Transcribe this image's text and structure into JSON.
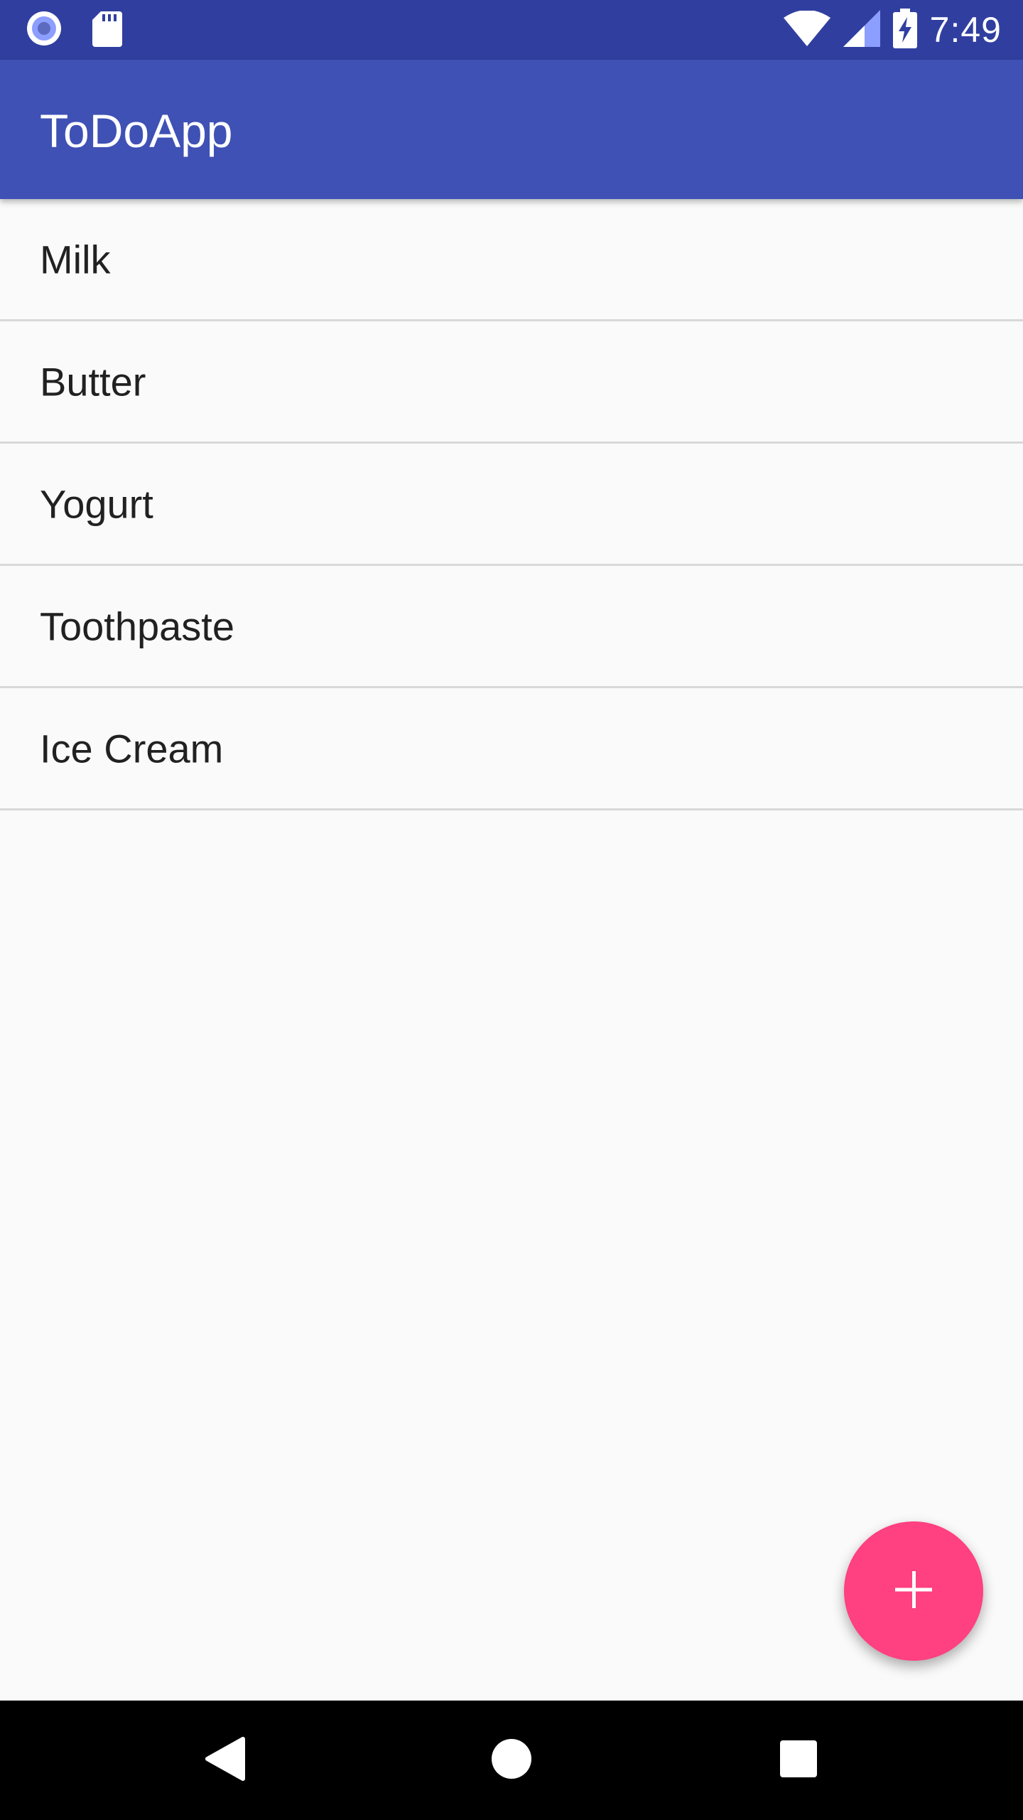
{
  "status_bar": {
    "time": "7:49",
    "left_icons": [
      "cast-record-icon",
      "sd-card-icon"
    ],
    "right_icons": [
      "wifi-icon",
      "cell-signal-icon",
      "battery-charging-icon"
    ]
  },
  "app_bar": {
    "title": "ToDoApp"
  },
  "todo_list": {
    "items": [
      {
        "label": "Milk"
      },
      {
        "label": "Butter"
      },
      {
        "label": "Yogurt"
      },
      {
        "label": "Toothpaste"
      },
      {
        "label": "Ice Cream"
      }
    ]
  },
  "fab": {
    "icon": "plus-icon"
  },
  "nav_bar": {
    "buttons": [
      "back-icon",
      "home-icon",
      "recents-icon"
    ]
  },
  "colors": {
    "status_bar": "#303f9f",
    "primary": "#3f51b5",
    "accent": "#ff4081",
    "background": "#fafafa",
    "divider": "#d8d8d8",
    "text": "#212121"
  }
}
